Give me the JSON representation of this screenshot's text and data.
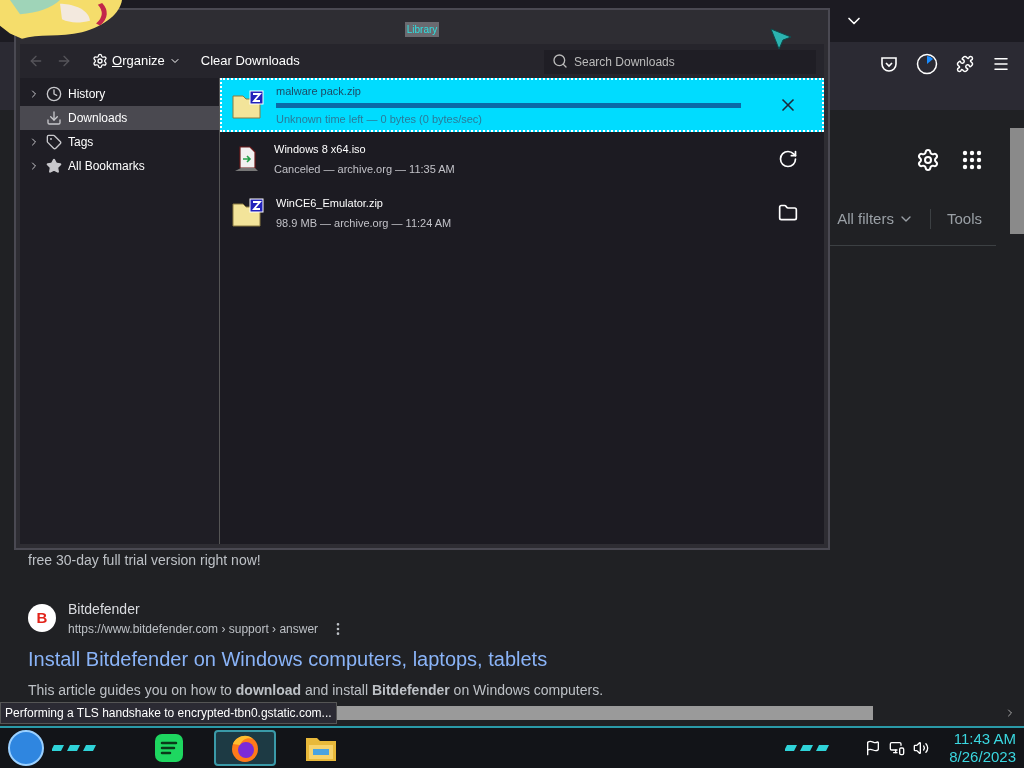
{
  "library": {
    "title": "Library",
    "toolbar": {
      "organize": "Organize",
      "clear": "Clear Downloads",
      "search": {
        "placeholder": "Search Downloads"
      }
    },
    "sidebar": [
      {
        "label": "History",
        "expandable": true,
        "selected": false
      },
      {
        "label": "Downloads",
        "expandable": false,
        "selected": true
      },
      {
        "label": "Tags",
        "expandable": true,
        "selected": false
      },
      {
        "label": "All Bookmarks",
        "expandable": true,
        "selected": false
      }
    ],
    "downloads": [
      {
        "kind": "downloading",
        "name": "malware pack.zip",
        "status": "Unknown time left — 0 bytes (0 bytes/sec)",
        "selected": true
      },
      {
        "kind": "canceled",
        "name": "Windows 8 x64.iso",
        "status": "Canceled — archive.org — 11:35 AM",
        "selected": false
      },
      {
        "kind": "finished",
        "name": "WinCE6_Emulator.zip",
        "status": "98.9 MB — archive.org — 11:24 AM",
        "selected": false
      }
    ]
  },
  "browser": {
    "search_tools": {
      "filters": "All filters",
      "tools": "Tools"
    },
    "snippet_top": "free 30-day full trial version right now!",
    "result": {
      "favicon": "B",
      "site": "Bitdefender",
      "url": "https://www.bitdefender.com › support › answer",
      "title": "Install Bitdefender on Windows computers, laptops, tablets",
      "snippet": "This article guides you on how to **download** and install **Bitdefender** on Windows computers."
    }
  },
  "status_bar": "Performing a TLS handshake to encrypted-tbn0.gstatic.com...",
  "taskbar": {
    "apps": [
      {
        "kind": "music",
        "active": false
      },
      {
        "kind": "browser",
        "active": true
      },
      {
        "kind": "files",
        "active": false
      }
    ],
    "clock": {
      "time": "11:43 AM",
      "date": "8/26/2023"
    }
  }
}
